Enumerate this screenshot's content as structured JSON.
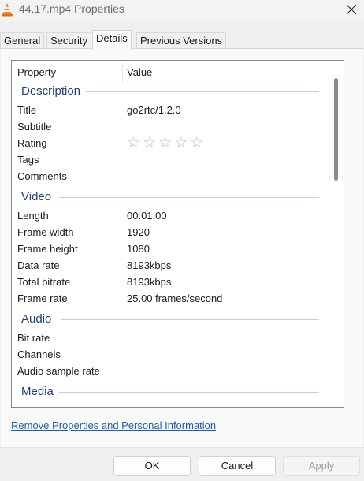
{
  "window": {
    "title": "44.17.mp4 Properties"
  },
  "tabs": [
    {
      "label": "General"
    },
    {
      "label": "Security"
    },
    {
      "label": "Details"
    },
    {
      "label": "Previous Versions"
    }
  ],
  "table": {
    "header_property": "Property",
    "header_value": "Value"
  },
  "groups": {
    "description": {
      "name": "Description",
      "rows": [
        {
          "property": "Title",
          "value": "go2rtc/1.2.0"
        },
        {
          "property": "Subtitle",
          "value": ""
        },
        {
          "property": "Rating",
          "value": ""
        },
        {
          "property": "Tags",
          "value": ""
        },
        {
          "property": "Comments",
          "value": ""
        }
      ],
      "rating_stars": "☆☆☆☆☆"
    },
    "video": {
      "name": "Video",
      "rows": [
        {
          "property": "Length",
          "value": "00:01:00"
        },
        {
          "property": "Frame width",
          "value": "1920"
        },
        {
          "property": "Frame height",
          "value": "1080"
        },
        {
          "property": "Data rate",
          "value": "8193kbps"
        },
        {
          "property": "Total bitrate",
          "value": "8193kbps"
        },
        {
          "property": "Frame rate",
          "value": "25.00 frames/second"
        }
      ]
    },
    "audio": {
      "name": "Audio",
      "rows": [
        {
          "property": "Bit rate",
          "value": ""
        },
        {
          "property": "Channels",
          "value": ""
        },
        {
          "property": "Audio sample rate",
          "value": ""
        }
      ]
    },
    "media": {
      "name": "Media"
    }
  },
  "link_text": "Remove Properties and Personal Information",
  "buttons": {
    "ok": "OK",
    "cancel": "Cancel",
    "apply": "Apply"
  },
  "icons": {
    "app": "vlc-cone-icon",
    "close": "close-icon"
  },
  "colors": {
    "group_header": "#1e3e7c",
    "link": "#1a5fb4",
    "vlc_orange": "#f28c28"
  }
}
